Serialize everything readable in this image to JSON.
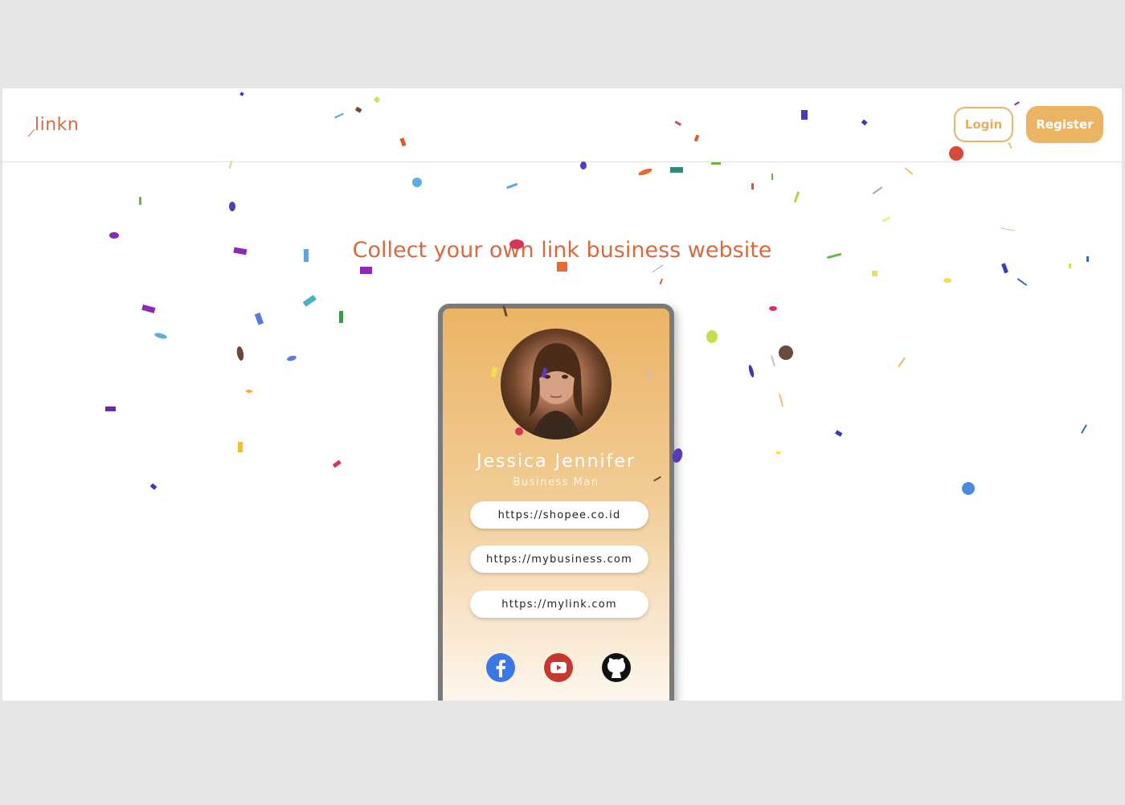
{
  "app": {
    "logo_text": "linkn"
  },
  "header": {
    "login_label": "Login",
    "register_label": "Register"
  },
  "hero": {
    "headline": "Collect your own link business website"
  },
  "profile": {
    "name": "Jessica Jennifer",
    "title": "Business Man",
    "links": [
      "https://shopee.co.id",
      "https://mybusiness.com",
      "https://mylink.com"
    ],
    "socials": [
      {
        "icon": "facebook-icon",
        "color": "#3b78e7"
      },
      {
        "icon": "youtube-icon",
        "color": "#c8372d"
      },
      {
        "icon": "github-icon",
        "color": "#111111"
      }
    ]
  },
  "colors": {
    "brand": "#d9693f",
    "accent": "#ebb463",
    "background": "#e5e5e5"
  }
}
